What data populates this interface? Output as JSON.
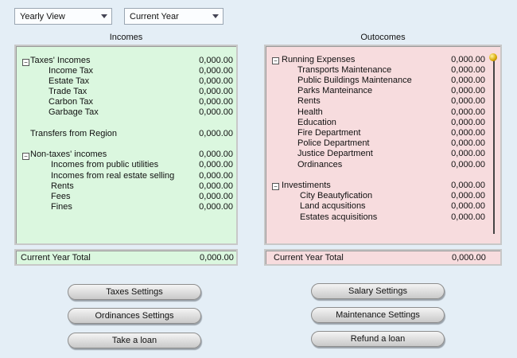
{
  "selects": {
    "view": "Yearly View",
    "period": "Current Year"
  },
  "incomes": {
    "title": "Incomes",
    "rows": [
      {
        "label": "Taxes' Incomes",
        "value": "0,000.00"
      },
      {
        "label": "Income Tax",
        "value": "0,000.00"
      },
      {
        "label": "Estate Tax",
        "value": "0,000.00"
      },
      {
        "label": "Trade Tax",
        "value": "0,000.00"
      },
      {
        "label": "Carbon Tax",
        "value": "0,000.00"
      },
      {
        "label": "Garbage Tax",
        "value": "0,000.00"
      },
      {
        "label": "Transfers from Region",
        "value": "0,000.00"
      },
      {
        "label": "Non-taxes' incomes",
        "value": "0,000.00"
      },
      {
        "label": "Incomes from public utilities",
        "value": "0,000.00"
      },
      {
        "label": "Incomes from real estate selling",
        "value": "0,000.00"
      },
      {
        "label": "Rents",
        "value": "0,000.00"
      },
      {
        "label": "Fees",
        "value": "0,000.00"
      },
      {
        "label": "Fines",
        "value": "0,000.00"
      }
    ],
    "total_label": "Current Year  Total",
    "total_value": "0,000.00"
  },
  "outcomes": {
    "title": "Outocomes",
    "rows": [
      {
        "label": "Running Expenses",
        "value": "0,000.00"
      },
      {
        "label": "Transports Maintenance",
        "value": "0,000.00"
      },
      {
        "label": "Public Buildings Maintenance",
        "value": "0,000.00"
      },
      {
        "label": "Parks Manteinance",
        "value": "0,000.00"
      },
      {
        "label": "Rents",
        "value": "0,000.00"
      },
      {
        "label": "Health",
        "value": "0,000.00"
      },
      {
        "label": "Education",
        "value": "0,000.00"
      },
      {
        "label": "Fire Department",
        "value": "0,000.00"
      },
      {
        "label": "Police Department",
        "value": "0,000.00"
      },
      {
        "label": "Justice Department",
        "value": "0,000.00"
      },
      {
        "label": "Ordinances",
        "value": "0,000.00"
      },
      {
        "label": "Investiments",
        "value": "0,000.00"
      },
      {
        "label": "City Beautyfication",
        "value": "0,000.00"
      },
      {
        "label": "Land acqusitions",
        "value": "0,000.00"
      },
      {
        "label": "Estates acquisitions",
        "value": "0,000.00"
      }
    ],
    "total_label": "Current Year  Total",
    "total_value": "0,000.00"
  },
  "buttons": {
    "taxes_settings": "Taxes Settings",
    "ordinances_settings": "Ordinances Settings",
    "take_loan": "Take a loan",
    "salary_settings": "Salary Settings",
    "maintenance_settings": "Maintenance Settings",
    "refund_loan": "Refund a loan"
  },
  "icons": {
    "collapse": "minus-box-icon"
  }
}
